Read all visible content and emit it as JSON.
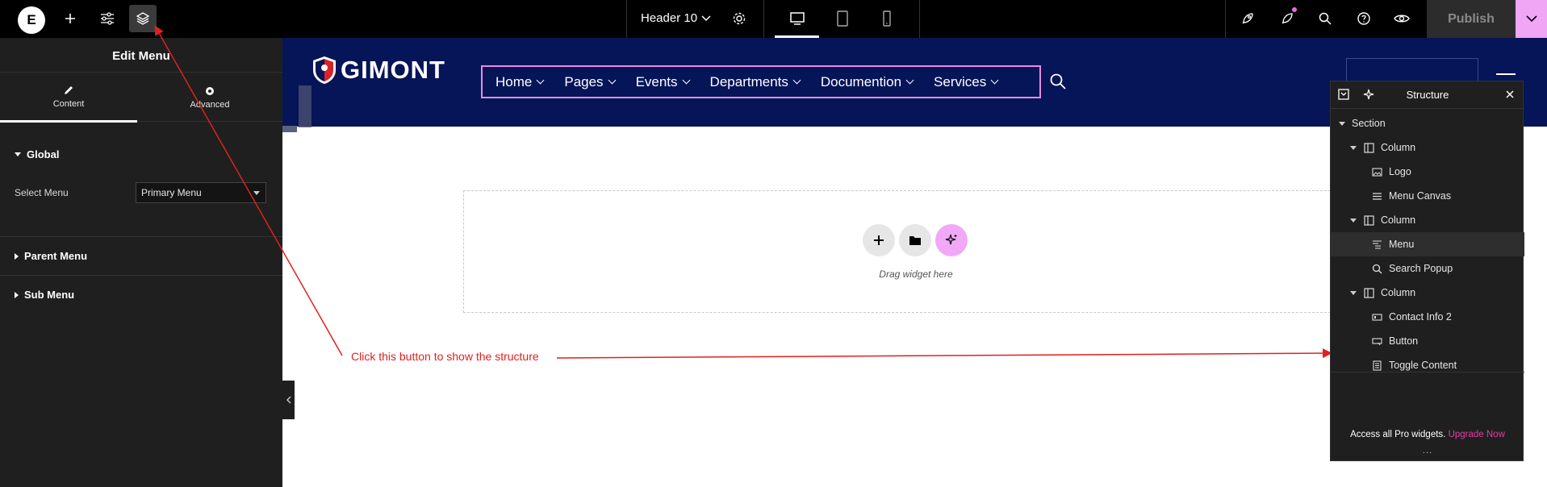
{
  "topbar": {
    "logo_letter": "E",
    "document_title": "Header 10",
    "publish_label": "Publish",
    "icons": [
      "elementor-logo-icon",
      "plus-icon",
      "sliders-icon",
      "layers-icon",
      "chevron-down-icon",
      "gear-icon",
      "desktop-icon",
      "tablet-icon",
      "mobile-icon",
      "rocket-icon",
      "sparkle-notify-icon",
      "search-icon",
      "help-icon",
      "eye-icon",
      "chevron-down-icon"
    ],
    "active_device": "desktop"
  },
  "left_panel": {
    "title": "Edit Menu",
    "tabs": [
      {
        "label": "Content"
      },
      {
        "label": "Advanced"
      }
    ],
    "active_tab": "Content",
    "sections": {
      "global": "Global",
      "parent_menu": "Parent Menu",
      "sub_menu": "Sub Menu"
    },
    "select_menu_label": "Select Menu",
    "select_menu_value": "Primary Menu"
  },
  "site_header": {
    "brand": "GIMONT",
    "menu": [
      {
        "label": "Home"
      },
      {
        "label": "Pages"
      },
      {
        "label": "Events"
      },
      {
        "label": "Departments"
      },
      {
        "label": "Documention"
      },
      {
        "label": "Services"
      }
    ],
    "background": "#061458",
    "menu_outline": "#e68be0"
  },
  "dropzone": {
    "text": "Drag widget here"
  },
  "annotation": {
    "text": "Click this button to show the structure",
    "color": "#e02020"
  },
  "structure": {
    "title": "Structure",
    "items": [
      {
        "label": "Section",
        "type": "section",
        "icon": "caret"
      },
      {
        "label": "Column",
        "type": "column",
        "icon": "column-icon"
      },
      {
        "label": "Logo",
        "type": "widget",
        "icon": "image-icon"
      },
      {
        "label": "Menu Canvas",
        "type": "widget",
        "icon": "lines-icon"
      },
      {
        "label": "Column",
        "type": "column",
        "icon": "column-icon"
      },
      {
        "label": "Menu",
        "type": "widget",
        "icon": "menu-icon",
        "selected": true
      },
      {
        "label": "Search Popup",
        "type": "widget",
        "icon": "search-icon"
      },
      {
        "label": "Column",
        "type": "column",
        "icon": "column-icon"
      },
      {
        "label": "Contact Info 2",
        "type": "widget",
        "icon": "contact-icon"
      },
      {
        "label": "Button",
        "type": "widget",
        "icon": "button-icon"
      },
      {
        "label": "Toggle Content",
        "type": "widget",
        "icon": "doc-icon"
      }
    ],
    "footer_text": "Access all Pro widgets.",
    "footer_link": "Upgrade Now",
    "footer_more": "..."
  }
}
